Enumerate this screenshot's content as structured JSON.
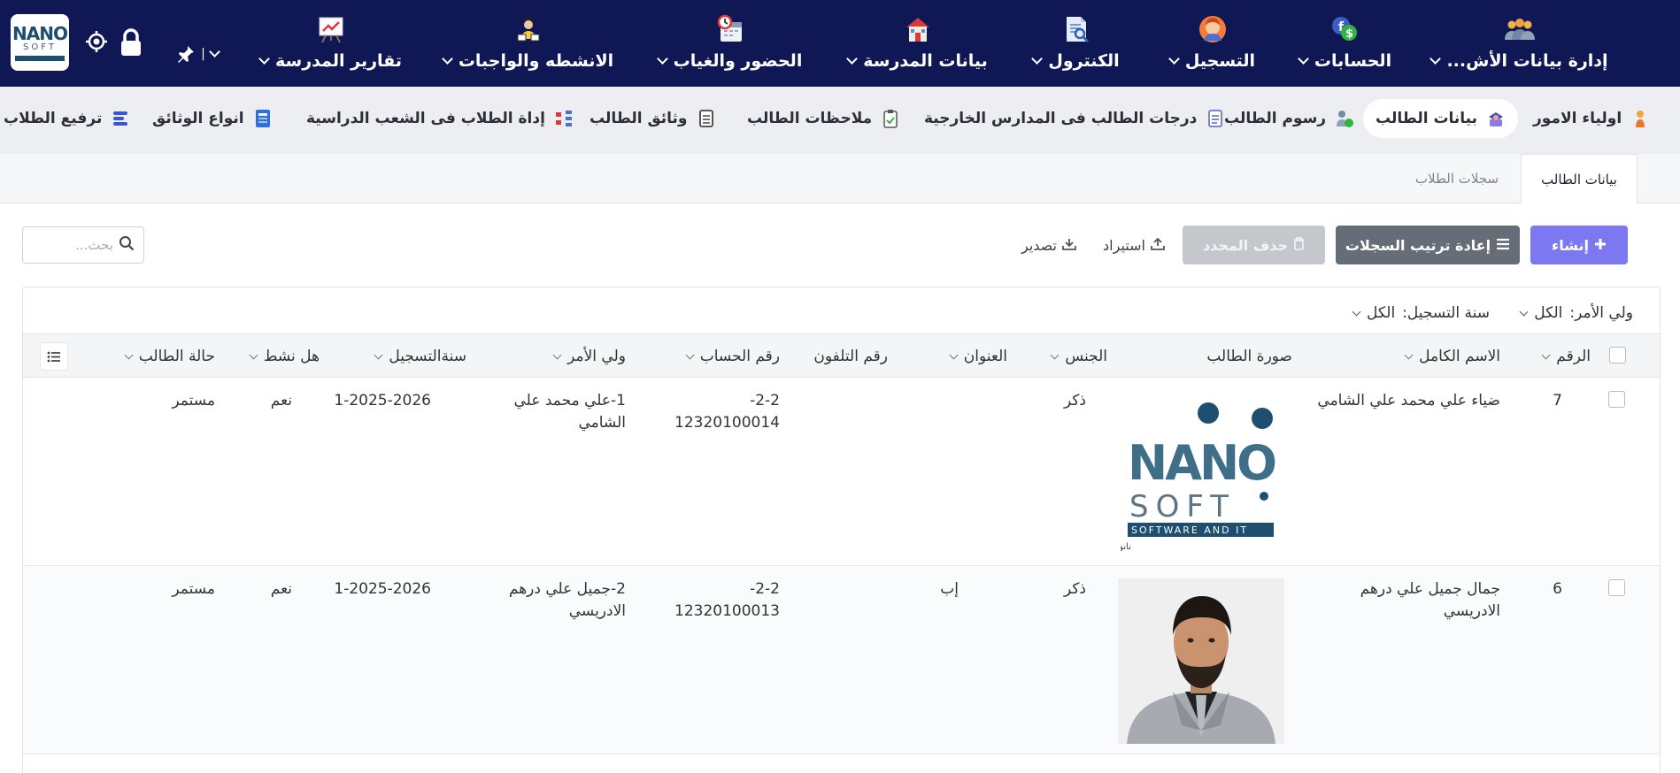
{
  "logo": {
    "line1": "NANO",
    "line2": "SOFT"
  },
  "top_menu": [
    {
      "label": "إدارة بيانات الأش...",
      "icon": "people-group-icon"
    },
    {
      "label": "الحسابات",
      "icon": "facebook-dollar-icon"
    },
    {
      "label": "التسجيل",
      "icon": "person-icon"
    },
    {
      "label": "الكنترول",
      "icon": "document-search-icon"
    },
    {
      "label": "بيانات المدرسة",
      "icon": "school-house-icon"
    },
    {
      "label": "الحضور والغياب",
      "icon": "calendar-clock-icon"
    },
    {
      "label": "الانشطه والواجبات",
      "icon": "students-icon"
    },
    {
      "label": "تقارير المدرسة",
      "icon": "chart-board-icon"
    }
  ],
  "top_tools": {
    "pin_text": "|"
  },
  "sub_menu": [
    {
      "label": "اولياء الامور",
      "icon": "guardian-icon"
    },
    {
      "label": "بيانات الطالب",
      "icon": "student-data-icon"
    },
    {
      "label": "رسوم الطالب",
      "icon": "fees-icon"
    },
    {
      "label": "درجات الطالب فى المدارس الخارجية",
      "icon": "grades-list-icon"
    },
    {
      "label": "ملاحظات الطالب",
      "icon": "clipboard-check-icon"
    },
    {
      "label": "وثائق الطالب",
      "icon": "document-icon"
    },
    {
      "label": "إداة الطلاب فى الشعب الدراسية",
      "icon": "sections-icon"
    },
    {
      "label": "انواع الوثائق",
      "icon": "document-types-icon"
    },
    {
      "label": "ترفيع الطلاب",
      "icon": "promote-icon"
    }
  ],
  "tabs": {
    "active": "بيانات الطالب",
    "inactive": "سجلات الطلاب"
  },
  "actions": {
    "create": "إنشاء",
    "reorder": "إعادة ترتيب السجلات",
    "delete_selected": "حذف المحدد",
    "import": "استيراد",
    "export": "تصدير",
    "search_placeholder": "بحث..."
  },
  "filters": {
    "guardian_label": "ولي الأمر:",
    "guardian_value": "الكل",
    "year_label": "سنة التسجيل:",
    "year_value": "الكل"
  },
  "columns": {
    "number": "الرقم",
    "full_name": "الاسم الكامل",
    "photo": "صورة الطالب",
    "gender": "الجنس",
    "address": "العنوان",
    "phone": "رقم التلفون",
    "account": "رقم الحساب",
    "guardian": "ولي الأمر",
    "reg_year": "سنةالتسجيل",
    "active": "هل نشط",
    "status": "حالة الطالب"
  },
  "rows": [
    {
      "number": "7",
      "full_name": "ضياء علي محمد علي الشامي",
      "photo": "nano-soft-logo",
      "gender": "ذكر",
      "address": "",
      "phone": "",
      "account": "2-2-\n12320100014",
      "guardian": "1-علي محمد علي\nالشامي",
      "reg_year": "1-2025-2026",
      "active": "نعم",
      "status": "مستمر"
    },
    {
      "number": "6",
      "full_name": "جمال جميل علي درهم\nالادريسي",
      "photo": "student-portrait",
      "gender": "ذكر",
      "address": "إب",
      "phone": "",
      "account": "2-2-\n12320100013",
      "guardian": "2-جميل علي درهم\nالادريسي",
      "reg_year": "1-2025-2026",
      "active": "نعم",
      "status": "مستمر"
    }
  ],
  "photo_logo": {
    "big": "NANO",
    "sub": "SOFT",
    "band": "SOFTWARE AND IT",
    "tagline": "نانو سوفت للبرمجيات و تقنية المعلومات"
  },
  "colors": {
    "topbar": "#0f1855",
    "create_button": "#7b78f2",
    "reorder_button": "#666d77",
    "delete_button": "#c4c7cc"
  }
}
